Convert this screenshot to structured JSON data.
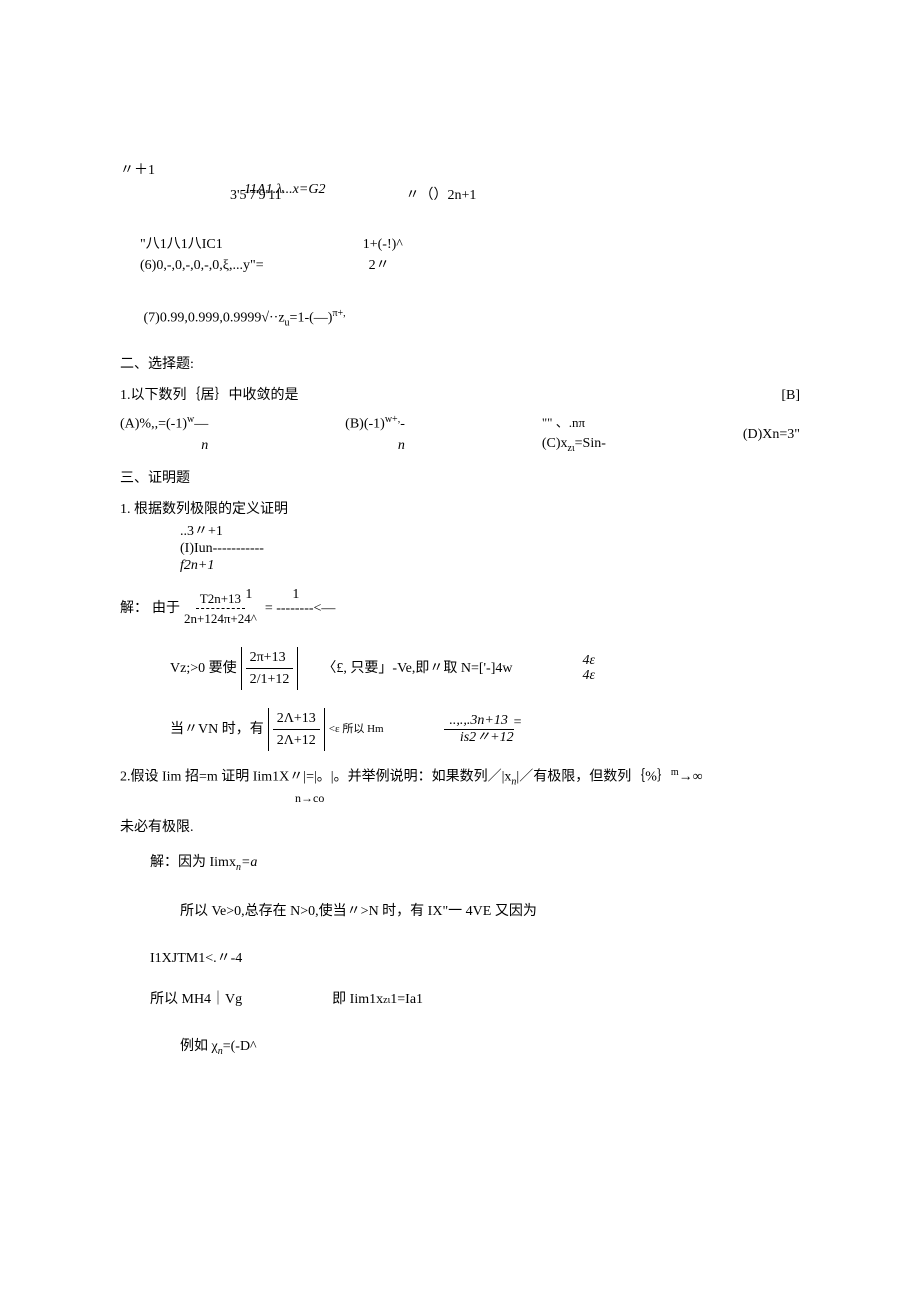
{
  "line1": "〃＋1",
  "line2_left": "3'5'7'9'11'",
  "line2_center": "11A1.λ...x=G2",
  "line2_right": "〃（）2n+1",
  "line3_left": "\"八1八1八IC1",
  "line3_right": "1+(-!)^",
  "line4_left": "(6)0,-,0,-,0,-,0,ξ,...y\"=",
  "line4_right": "2〃",
  "line5": "(7)0.99,0.999,0.9999√··z",
  "line5_sub": "u",
  "line5_tail": "=1-(—)",
  "line5_exp": "π+,",
  "sec2_title": "二、选择题:",
  "q1_text": "1.以下数列｛居｝中收敛的是",
  "q1_answer": "[B]",
  "optA_1": "(A)%,,=(-1)",
  "optA_exp": "w",
  "optA_tail": "—",
  "optA_under": "n",
  "optB_1": "(B)(-1)",
  "optB_exp": "w+,",
  "optB_tail": "-",
  "optB_under": "n",
  "optC_top1": "\"\"",
  "optC_top2": "、.nπ",
  "optC_1": "(C)x",
  "optC_sub": "zι",
  "optC_tail": "=Sin-",
  "optD_1": "(D)Xn=3\"",
  "sec3_title": "三、证明题",
  "p1_title": "1. 根据数列极限的定义证明",
  "p1_line1": "..3〃+1",
  "p1_line2": "(I)Iun-----------",
  "p1_line3": "f2n+1",
  "sol_label": "解：",
  "sol_prefix": "由于",
  "sol_num": "T2n+13",
  "sol_den": "2n+124π+24^",
  "sol_eq": "=  --------<—",
  "sol_one_a": "1",
  "sol_one_b": "1",
  "vz_label": "Vz;>0 要使",
  "abs1_top": "2π+13",
  "abs1_bot": "2/1+12",
  "vz_right": "〈£, 只要」-Ve,即〃取 N=['-]4w",
  "vz_4e_a": "4ε",
  "vz_4e_b": "4ε",
  "vn_label": "当〃VN 时，有",
  "abs2_top": "2Λ+13",
  "abs2_bot": "2Λ+12",
  "vn_mid": "<ε 所以 Hm",
  "vn_right_top": "..,.,.3n+13",
  "vn_right_bot": "is2〃+12",
  "vn_right_sep": "=",
  "p2_text_a": "2.假设 Iim 招=m 证明 Iim1X〃|=|。|。并举例说明：如果数列／|x",
  "p2_sub": "n",
  "p2_text_b": "|／有极限，但数列｛%｝",
  "p2_exp": "m",
  "p2_text_c": "→∞",
  "p2_under": "n→co",
  "p2_cont": "未必有极限.",
  "p2_sol_label": "解：因为 Iimx",
  "p2_sol_sub": "n",
  "p2_sol_tail": "=a",
  "p2_line2": "所以 Ve>0,总存在 N>0,使当〃>N 时，有 IX\"一 4VE 又因为",
  "p2_line3": "I1XJTM1<.〃-4",
  "p2_line4_a": "所以 MH4｜Vg",
  "p2_line4_b": "即 Iim1x",
  "p2_line4_sub": "zι",
  "p2_line4_c": "1=Ia1",
  "p2_line5_a": "例如 χ",
  "p2_line5_sub": "n",
  "p2_line5_b": "=(-D^"
}
